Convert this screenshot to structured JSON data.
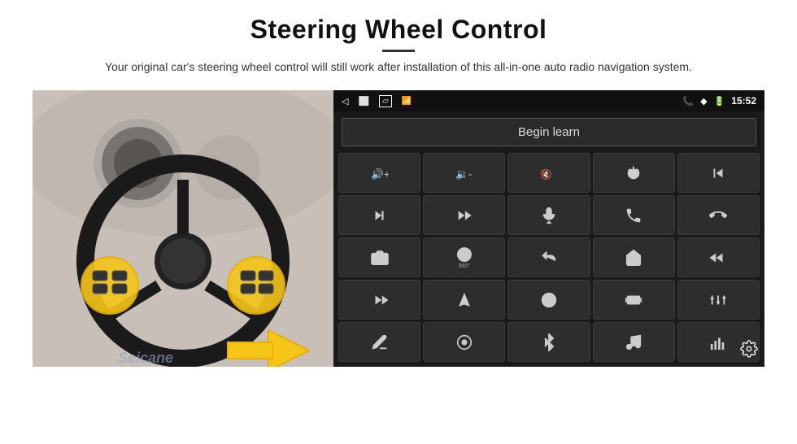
{
  "header": {
    "title": "Steering Wheel Control",
    "subtitle": "Your original car's steering wheel control will still work after installation of this all-in-one auto radio navigation system."
  },
  "status_bar": {
    "time": "15:52",
    "back_icon": "◁",
    "home_icon": "⬜",
    "recents_icon": "▱",
    "signal_icon": "📶",
    "phone_icon": "📞",
    "wifi_icon": "◆",
    "battery_icon": "🔋"
  },
  "begin_learn": {
    "label": "Begin learn"
  },
  "controls": [
    {
      "icon": "vol_up",
      "symbol": "🔊+"
    },
    {
      "icon": "vol_down",
      "symbol": "🔊-"
    },
    {
      "icon": "mute",
      "symbol": "🔇"
    },
    {
      "icon": "power",
      "symbol": "⏻"
    },
    {
      "icon": "prev_track",
      "symbol": "⏮"
    },
    {
      "icon": "next_track",
      "symbol": "⏭"
    },
    {
      "icon": "seek_next",
      "symbol": "⏭⏭"
    },
    {
      "icon": "mic",
      "symbol": "🎤"
    },
    {
      "icon": "phone",
      "symbol": "📞"
    },
    {
      "icon": "hang_up",
      "symbol": "📵"
    },
    {
      "icon": "camera",
      "symbol": "📷"
    },
    {
      "icon": "360",
      "symbol": "360"
    },
    {
      "icon": "back",
      "symbol": "↩"
    },
    {
      "icon": "home",
      "symbol": "🏠"
    },
    {
      "icon": "rew",
      "symbol": "⏮"
    },
    {
      "icon": "skip_fwd",
      "symbol": "⏭"
    },
    {
      "icon": "navigate",
      "symbol": "➤"
    },
    {
      "icon": "swap",
      "symbol": "⇄"
    },
    {
      "icon": "record",
      "symbol": "⏺"
    },
    {
      "icon": "eq",
      "symbol": "🎚"
    },
    {
      "icon": "pen",
      "symbol": "✏"
    },
    {
      "icon": "settings2",
      "symbol": "⚙"
    },
    {
      "icon": "bluetooth",
      "symbol": "⚡"
    },
    {
      "icon": "music",
      "symbol": "♪"
    },
    {
      "icon": "spectrum",
      "symbol": "📊"
    }
  ],
  "watermark": "Seicane",
  "settings_icon": "⚙"
}
